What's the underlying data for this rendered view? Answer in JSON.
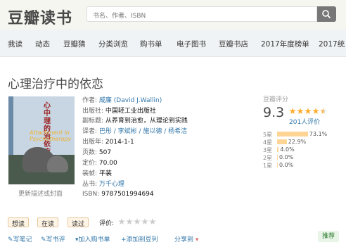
{
  "header": {
    "logo": "豆瓣读书",
    "search_placeholder": "书名、作者、ISBN"
  },
  "nav": {
    "items": [
      "我读",
      "动态",
      "豆瓣猜",
      "分类浏览",
      "购书单",
      "电子图书",
      "豆瓣书店",
      "2017年度榜单",
      "2017统"
    ]
  },
  "book": {
    "title": "心理治疗中的依恋",
    "cover": {
      "title_cn": "心中理的治依疗恋",
      "title_en": "Attachment in Psychotherapy",
      "link_text": "更新描述或封面"
    },
    "info": {
      "author_label": "作者:",
      "author": "威廉 (David J.Wallin)",
      "publisher_label": "出版社:",
      "publisher": "中国轻工业出版社",
      "subtitle_label": "副标题:",
      "subtitle": "从养育到治愈，从理论到实践",
      "translator_label": "译者:",
      "translators": "巴彤 / 李斌彬 / 施以德 / 杨希洁",
      "year_label": "出版年:",
      "year": "2014-1-1",
      "pages_label": "页数:",
      "pages": "507",
      "price_label": "定价:",
      "price": "70.00",
      "binding_label": "装帧:",
      "binding": "平装",
      "series_label": "丛书:",
      "series": "万千心理",
      "isbn_label": "ISBN:",
      "isbn": "9787501994694"
    }
  },
  "rating": {
    "label": "豆瓣评分",
    "score": "9.3",
    "stars": 4.5,
    "count": "201人评价",
    "breakdown": [
      {
        "label": "5星",
        "percent": 73.1,
        "text": "73.1%"
      },
      {
        "label": "4星",
        "percent": 22.9,
        "text": "22.9%"
      },
      {
        "label": "3星",
        "percent": 4.0,
        "text": "4.0%"
      },
      {
        "label": "2星",
        "percent": 0.0,
        "text": "0.0%"
      },
      {
        "label": "1星",
        "percent": 0.0,
        "text": "0.0%"
      }
    ]
  },
  "actions": {
    "want": "想读",
    "reading": "在读",
    "read": "读过",
    "evaluate": "评价:",
    "write_note": "写笔记",
    "write_review": "写书评",
    "add_cart": "加入购书单",
    "add_doulist": "添加到豆列",
    "share": "分享到",
    "recommend": "推荐"
  },
  "colors": {
    "link": "#3377aa",
    "star": "#ffac2d",
    "bar": "#ffd596",
    "nav_bg": "#f0f3f5"
  }
}
